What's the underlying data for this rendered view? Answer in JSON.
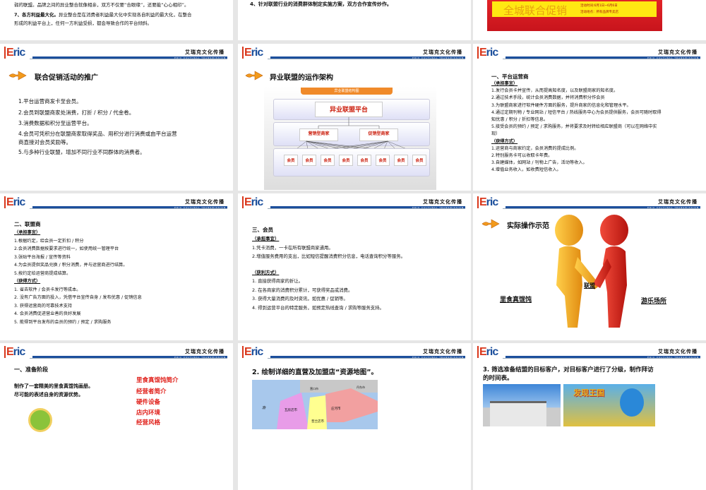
{
  "header": {
    "brand": "Eric",
    "company": "艾瑞克文化传播",
    "company_en": "ERIC CULTURAL TRANSMISSION"
  },
  "s1": {
    "lines": [
      "弱的联盟。品牌之间的异业整合就像相亲，双方不仅要“合眼缘”，还要能“心心相印”。",
      "7、各方利益最大化。",
      "异业整合是在消费者利益最大化中实现各自利益的最大化，在整合",
      "形成的利益平台上，任何一方利益受损，都会导致合作的平台倾斜。"
    ]
  },
  "s2": {
    "line": "4、针对联盟行业的消费群体制定实施方案，双方合作宣传炒作。"
  },
  "s3": {
    "poster_main": "全城联合促销",
    "poster_time": "活动时间:6月1日~6月6日",
    "poster_place": "活动地点：所有品牌专卖店"
  },
  "s4": {
    "title": "联合促销活动的推广",
    "items": [
      "1.平台运营商发卡至会员。",
      "2.会员到联盟商家处消费，打折 / 积分 / 代金卷。",
      "3.消费数据和积分至运营平台。",
      "4.会员可凭积分在联盟商家取得奖品、用积分进行消费或由平台运营",
      "商直接对会员奖励等。",
      "5.与多种行业联盟，增加不同行业不同群体的消费者。"
    ]
  },
  "s5": {
    "title": "异业联盟的运作架构",
    "diagram_title": "异业联盟结构图",
    "platform": "异业联盟平台",
    "merchant_a": "营销型商家",
    "merchant_b": "促销型商家",
    "member": "会员",
    "member_count": 8
  },
  "s6": {
    "heading": "一、平台运营商",
    "sub1": "（承担事宜）",
    "items1": [
      "1.发行会员卡并宣传，从而提高知名度，以及联盟商家的知名度。",
      "2.通过技术手段，统计会员消费数据，并将消费积分作会员",
      "3.为联盟商家进行软件硬件方面的服务，提升商家的信息化和管理水平。",
      "4.通过定期刊物 / 专业网站 / 短信平台 / 热线服务中心为会员提供服务，会员可随时取得",
      "知优惠 / 积分 / 折扣等信息。",
      "5.接受会员的预约 / 预定 / 求购服务，并将要求及时转给相应联盟商（可以在网络中实",
      "现）"
    ],
    "sub2": "（获得方式）",
    "items2": [
      "1.运营商与商家约定，会员消费的提成比例。",
      "2.特别服务卡可以收取卡年费。",
      "3.自建媒体，如网站 / 刊物上广告，活动等收入。",
      "4.增值业务收入，如收费短信收入。"
    ]
  },
  "s7": {
    "heading": "二、联盟商",
    "sub1": "（承担事宜）",
    "items1": [
      "1.根据约定，给会员一定折扣 / 积分",
      "2.会员消费数据按要求进行统一，如使用统一管理平台",
      "3.张贴平台海报 / 宣传等资料",
      "4.为会员提供奖品兑换 / 积分消费，并与运营商进行结算。",
      "5.按约定给运营商提成结算。"
    ],
    "sub2": "（获得方式）",
    "items2": [
      "1. 省去软件 / 会员卡发行等成本。",
      "2. 没有广告方面的投入，凭借平台宣传自身 / 发布优惠 / 促销信息",
      "3. 获得运营商的可靠技术支持",
      "4. 会员消费促进营业善的良好发展",
      "5. 能得到平台发布的会员的预约 / 预定 / 求购服务"
    ]
  },
  "s8": {
    "heading": "三、会员",
    "sub1": "（承担事宜）",
    "items1": [
      "1.凭卡消费，一卡在所有联盟商家通用。",
      "2.增值服务费用的支出，比如短信提醒消费积分信息，电话查询积分等服务。"
    ],
    "sub2": "（获利方式）",
    "items2": [
      "1. 直接获得商家的折让。",
      "2. 在各商家的消费积分累计，可获得奖品或消费。",
      "3. 获得大量消费的及时资讯，如优惠 / 促销等。",
      "4. 得到运营平台的特定服务，如预定热线查询 / 求购等服务支持。"
    ]
  },
  "s9": {
    "title": "实际操作示范",
    "left": "里食真馄饨",
    "center": "联盟",
    "right": "游乐场所"
  },
  "s10": {
    "heading": "一、准备阶段",
    "para": [
      "制作了一套精美的里食真馄饨画册。",
      "尽可能的表述自身的资源优势。"
    ],
    "red": [
      "里食真馄饨简介",
      "经营者简介",
      "硬件设备",
      "店内环境",
      "经营风格"
    ]
  },
  "s11": {
    "title": "2. 绘制详细的直营及加盟店“资源地图”。",
    "map_labels": [
      "营口市",
      "丹东市",
      "瓦房店市",
      "庄河市",
      "普兰店市",
      "渤"
    ]
  },
  "s12": {
    "title": [
      "3. 筛选准备结盟的目标客户，对目标客户进行了分级，制作拜访",
      "的时间表。"
    ],
    "park_logo": "发现王国"
  }
}
